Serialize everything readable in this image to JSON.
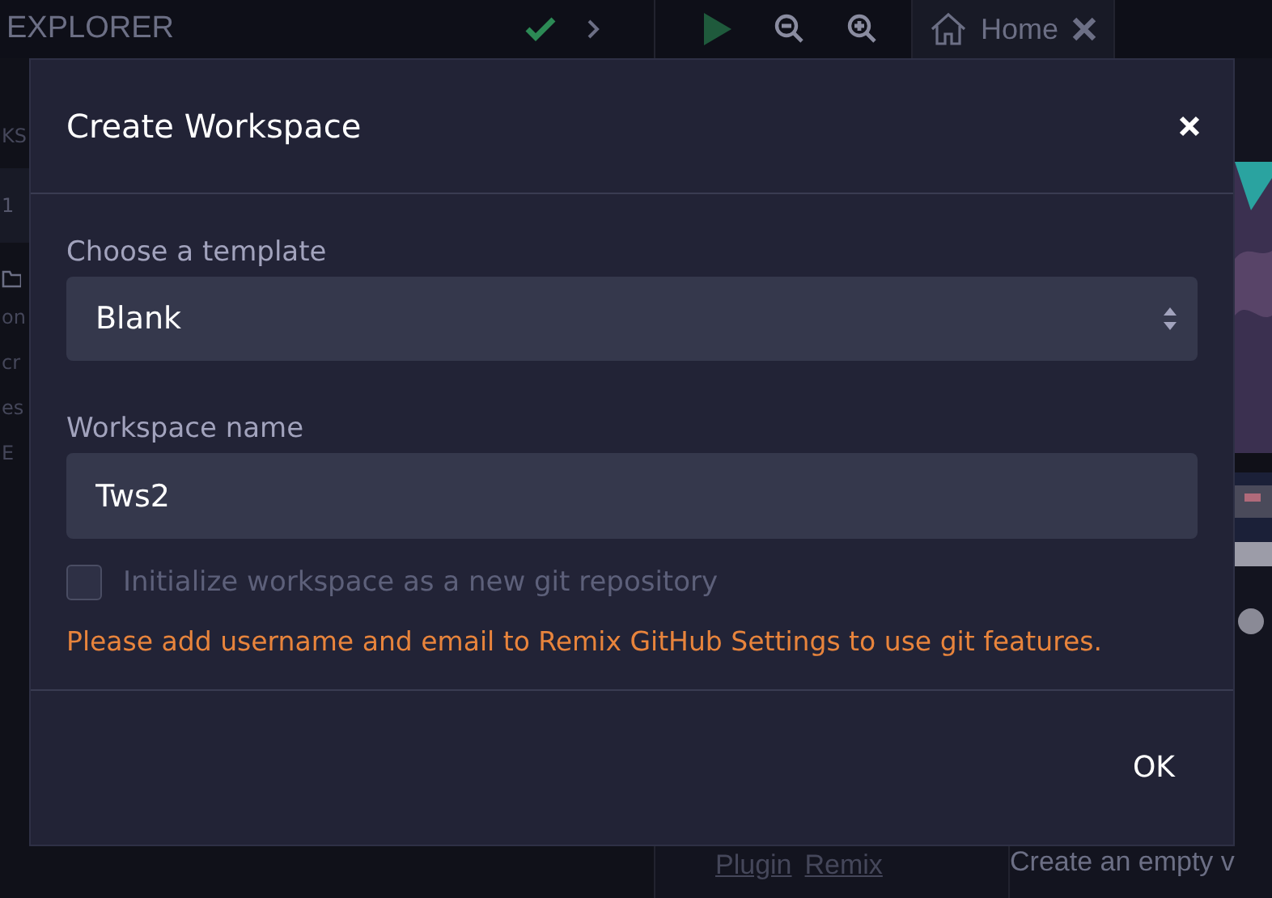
{
  "top_bar": {
    "panel_title": "EXPLORER",
    "home_tab": {
      "label": "Home",
      "selected": true
    }
  },
  "left_panel": {
    "heading": "KS",
    "items": [
      {
        "text": "1",
        "selected": true
      }
    ],
    "tree": [
      "on",
      "cr",
      "es",
      "E"
    ]
  },
  "main": {
    "links": [
      "Plugin",
      "Remix"
    ],
    "text": "Create an empty v"
  },
  "modal": {
    "title": "Create Workspace",
    "template_label": "Choose a template",
    "template_value": "Blank",
    "name_label": "Workspace name",
    "name_value": "Tws2",
    "git_checkbox": {
      "label": "Initialize workspace as a new git repository",
      "checked": false,
      "disabled": true
    },
    "warning": "Please add username and email to Remix GitHub Settings to use git features.",
    "buttons": [
      "OK"
    ]
  }
}
